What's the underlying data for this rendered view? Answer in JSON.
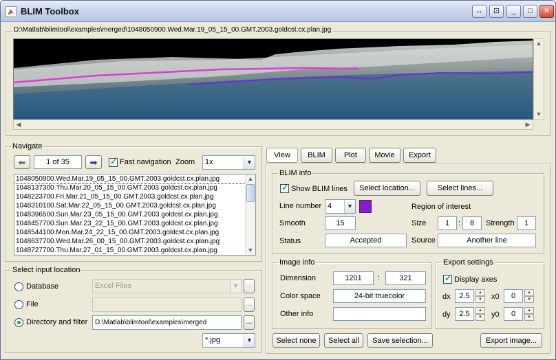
{
  "window": {
    "title": "BLIM Toolbox"
  },
  "image_panel": {
    "path": "D:\\Matlab\\blimtool\\examples\\merged\\1048050900.Wed.Mar.19_05_15_00.GMT.2003.goldcst.cx.plan.jpg"
  },
  "navigate": {
    "title": "Navigate",
    "counter": "1 of 35",
    "fast_nav_label": "Fast navigation",
    "fast_nav_checked": true,
    "zoom_label": "Zoom",
    "zoom_value": "1x",
    "files": [
      "1048050900.Wed.Mar.19_05_15_00.GMT.2003.goldcst.cx.plan.jpg",
      "1048137300.Thu.Mar.20_05_15_00.GMT.2003.goldcst.cx.plan.jpg",
      "1048223700.Fri.Mar.21_05_15_00.GMT.2003.goldcst.cx.plan.jpg",
      "1048310100.Sat.Mar.22_05_15_00.GMT.2003.goldcst.cx.plan.jpg",
      "1048396500.Sun.Mar.23_05_15_00.GMT.2003.goldcst.cx.plan.jpg",
      "1048457700.Sun.Mar.23_22_15_00.GMT.2003.goldcst.cx.plan.jpg",
      "1048544100.Mon.Mar.24_22_15_00.GMT.2003.goldcst.cx.plan.jpg",
      "1048637700.Wed.Mar.26_00_15_00.GMT.2003.goldcst.cx.plan.jpg",
      "1048727700.Thu.Mar.27_01_15_00.GMT.2003.goldcst.cx.plan.jpg"
    ]
  },
  "input_location": {
    "title": "Select input location",
    "database_label": "Database",
    "database_value": "Excel Files",
    "file_label": "File",
    "file_value": "",
    "dir_label": "Directory and filter",
    "dir_value": "D:\\Matlab\\blimtool\\examples\\merged",
    "filter_value": "*.jpg",
    "browse_label": "...",
    "selected": "directory"
  },
  "tabs": [
    "View",
    "BLIM",
    "Plot",
    "Movie",
    "Export"
  ],
  "blim_info": {
    "title": "BLIM info",
    "show_lines_label": "Show BLIM lines",
    "show_lines_checked": true,
    "select_location_label": "Select location...",
    "select_lines_label": "Select lines...",
    "line_number_label": "Line number",
    "line_number_value": "4",
    "line_color": "#8a19d6",
    "roi_label": "Region of interest",
    "smooth_label": "Smooth",
    "smooth_value": "15",
    "size_label": "Size",
    "size_a": "1",
    "size_sep": ":",
    "size_b": "8",
    "strength_label": "Strength",
    "strength_value": "1",
    "status_label": "Status",
    "status_value": "Accepted",
    "source_label": "Source",
    "source_value": "Another line"
  },
  "image_info": {
    "title": "Image info",
    "dimension_label": "Dimension",
    "dim_w": "1201",
    "dim_sep": ":",
    "dim_h": "321",
    "color_space_label": "Color space",
    "color_space_value": "24-bit truecolor",
    "other_info_label": "Other info",
    "other_info_value": ""
  },
  "export_settings": {
    "title": "Export settings",
    "display_axes_label": "Display axes",
    "display_axes_checked": true,
    "dx_label": "dx",
    "dx_value": "2.5",
    "x0_label": "x0",
    "x0_value": "0",
    "dy_label": "dy",
    "dy_value": "2.5",
    "y0_label": "y0",
    "y0_value": "0"
  },
  "bottom_buttons": {
    "select_none": "Select none",
    "select_all": "Select all",
    "save_selection": "Save selection...",
    "export_image": "Export image..."
  }
}
